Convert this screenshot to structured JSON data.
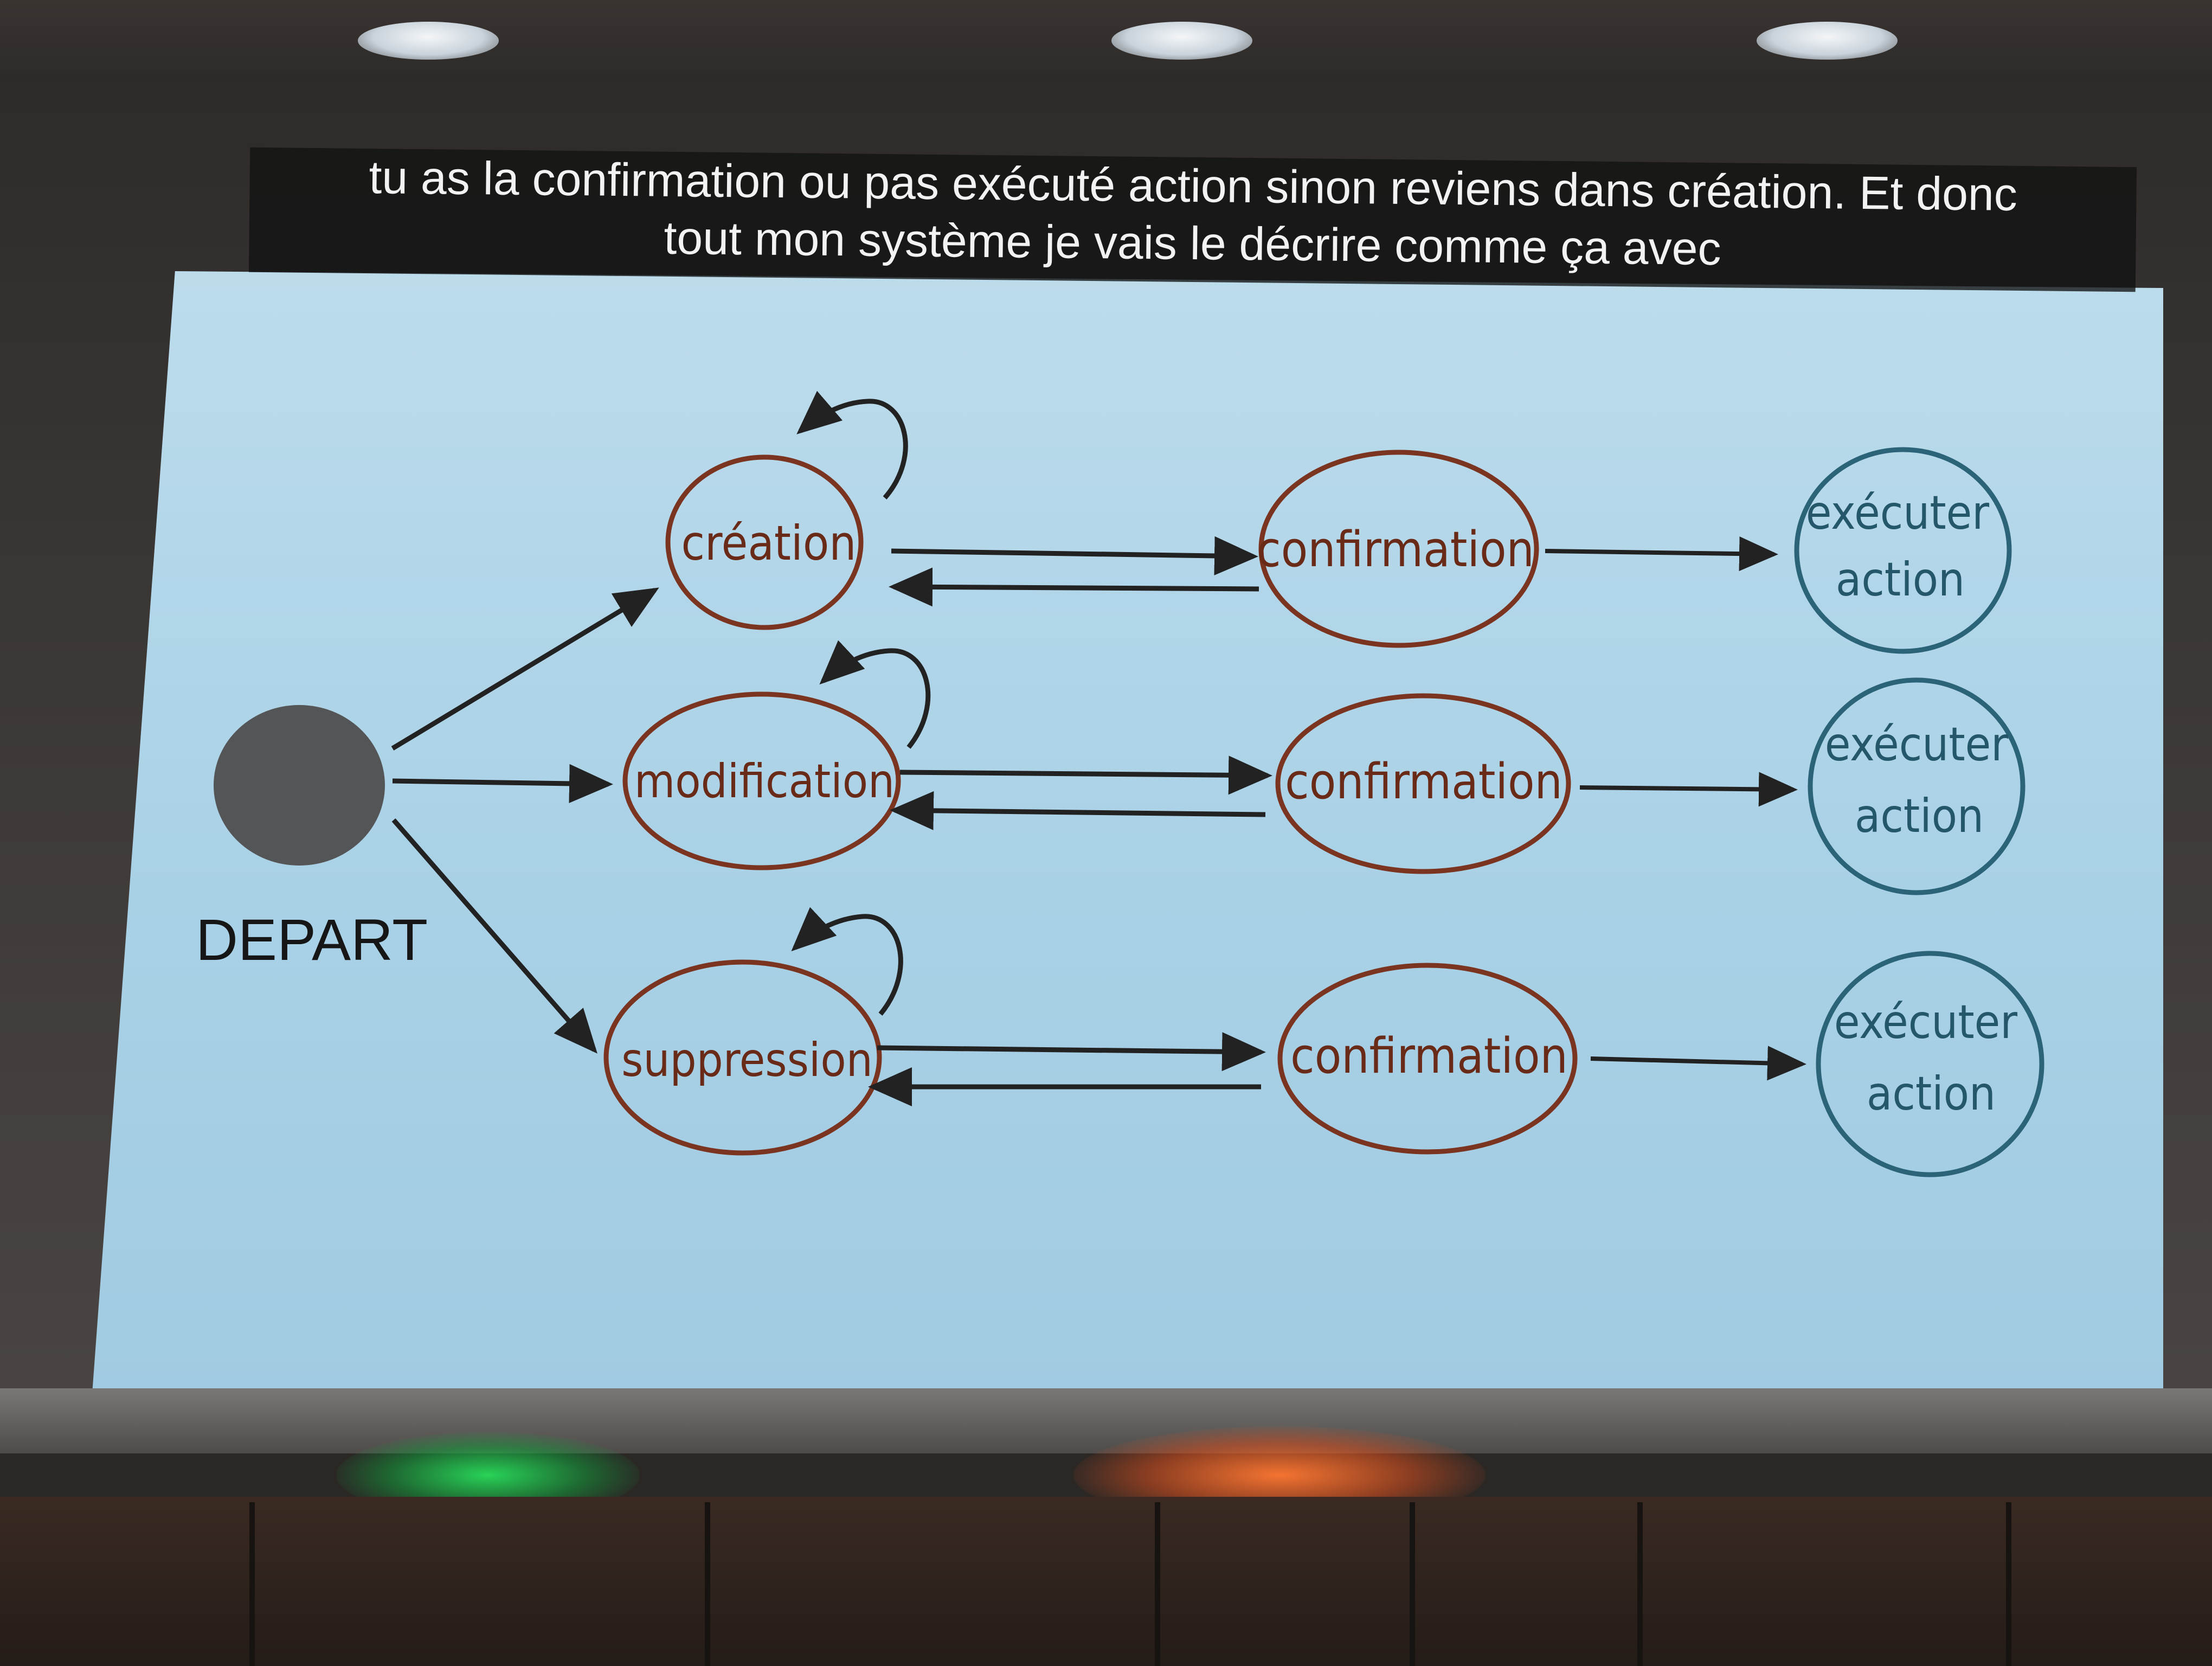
{
  "subtitle": {
    "line1": "tu as la confirmation ou pas exécuté action sinon reviens dans création. Et donc",
    "line2": "tout mon système je vais le décrire comme ça avec"
  },
  "diagram": {
    "start_label": "DEPART",
    "states": {
      "creation": "création",
      "modification": "modification",
      "suppression": "suppression",
      "confirmation": "confirmation",
      "execute_line1": "exécuter",
      "execute_line2": "action"
    }
  },
  "colors": {
    "slide_background": "#a9d1e6",
    "state_stroke": "#7a3420",
    "state_text": "#6a2a18",
    "terminal_stroke": "#2b6478",
    "terminal_text": "#24576a",
    "start_dot": "#545556",
    "arrow": "#222222"
  }
}
